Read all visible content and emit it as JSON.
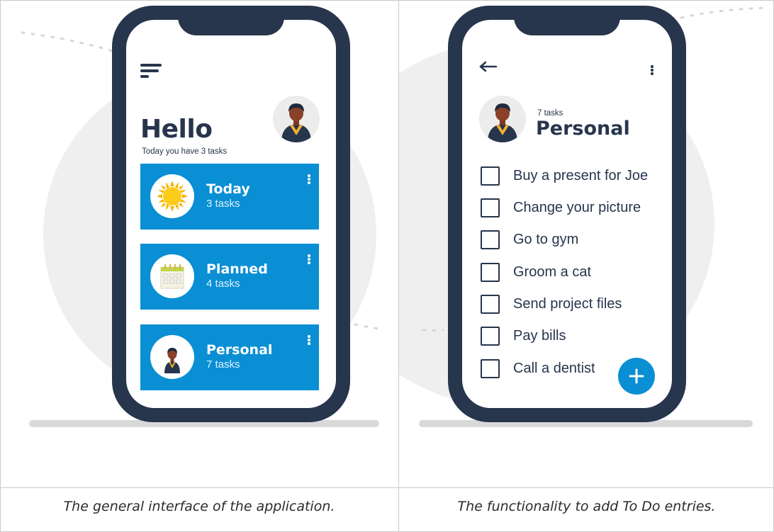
{
  "left_phone": {
    "greeting": "Hello",
    "subtitle": "Today you have 3 tasks",
    "cards": [
      {
        "title": "Today",
        "count": "3 tasks",
        "icon": "sun-icon"
      },
      {
        "title": "Planned",
        "count": "4 tasks",
        "icon": "calendar-icon"
      },
      {
        "title": "Personal",
        "count": "7 tasks",
        "icon": "person-avatar-icon"
      }
    ]
  },
  "right_phone": {
    "task_count": "7 tasks",
    "list_title": "Personal",
    "tasks": [
      "Buy a present for Joe",
      "Change your picture",
      "Go to gym",
      "Groom a cat",
      "Send project files",
      "Pay bills",
      "Call a dentist"
    ],
    "add_button": "+"
  },
  "captions": {
    "left": "The general interface of the application.",
    "right": "The functionality to add To Do entries."
  },
  "colors": {
    "phone_frame": "#27354d",
    "card_blue": "#0a8fd4",
    "background_blob": "#efeff0"
  }
}
